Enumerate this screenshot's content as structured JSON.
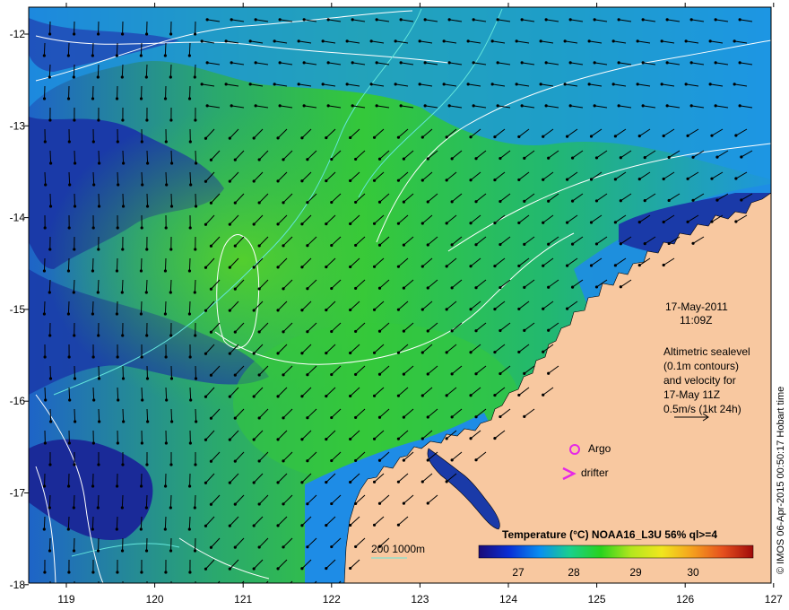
{
  "map": {
    "date_line1": "17-May-2011",
    "date_line2": "11:09Z",
    "altimetry_lines": [
      "Altimetric sealevel",
      "(0.1m contours)",
      "and velocity for",
      "17-May 11Z",
      "0.5m/s (1kt 24h)"
    ],
    "credit": "© IMOS 06-Apr-2015 00:50:17 Hobart time",
    "legend": {
      "title": "Temperature (°C) NOAA16_L3U 56% ql>=4",
      "ticks": [
        "27",
        "28",
        "29",
        "30"
      ],
      "colors": [
        "#1a0a78",
        "#0a2fd6",
        "#0a8ef0",
        "#1ad08c",
        "#28d21e",
        "#b4e61e",
        "#f0e61e",
        "#f5a01e",
        "#e6501e",
        "#a00a0a"
      ]
    },
    "bathy_label": "200  1000m",
    "argo_label": "Argo",
    "drifter_label": "drifter",
    "x_ticks": [
      "119",
      "120",
      "121",
      "122",
      "123",
      "124",
      "125",
      "126",
      "127"
    ],
    "y_ticks": [
      "-12",
      "-13",
      "-14",
      "-15",
      "-16",
      "-17",
      "-18"
    ],
    "colors": {
      "land": "#f8c8a0",
      "ocean_warm": "#2ec850",
      "ocean_cool": "#1e8ce6",
      "ocean_cold": "#14329a",
      "magenta": "#e628e6",
      "contour_white": "#ffffff",
      "contour_cyan": "#64e6dc"
    }
  }
}
